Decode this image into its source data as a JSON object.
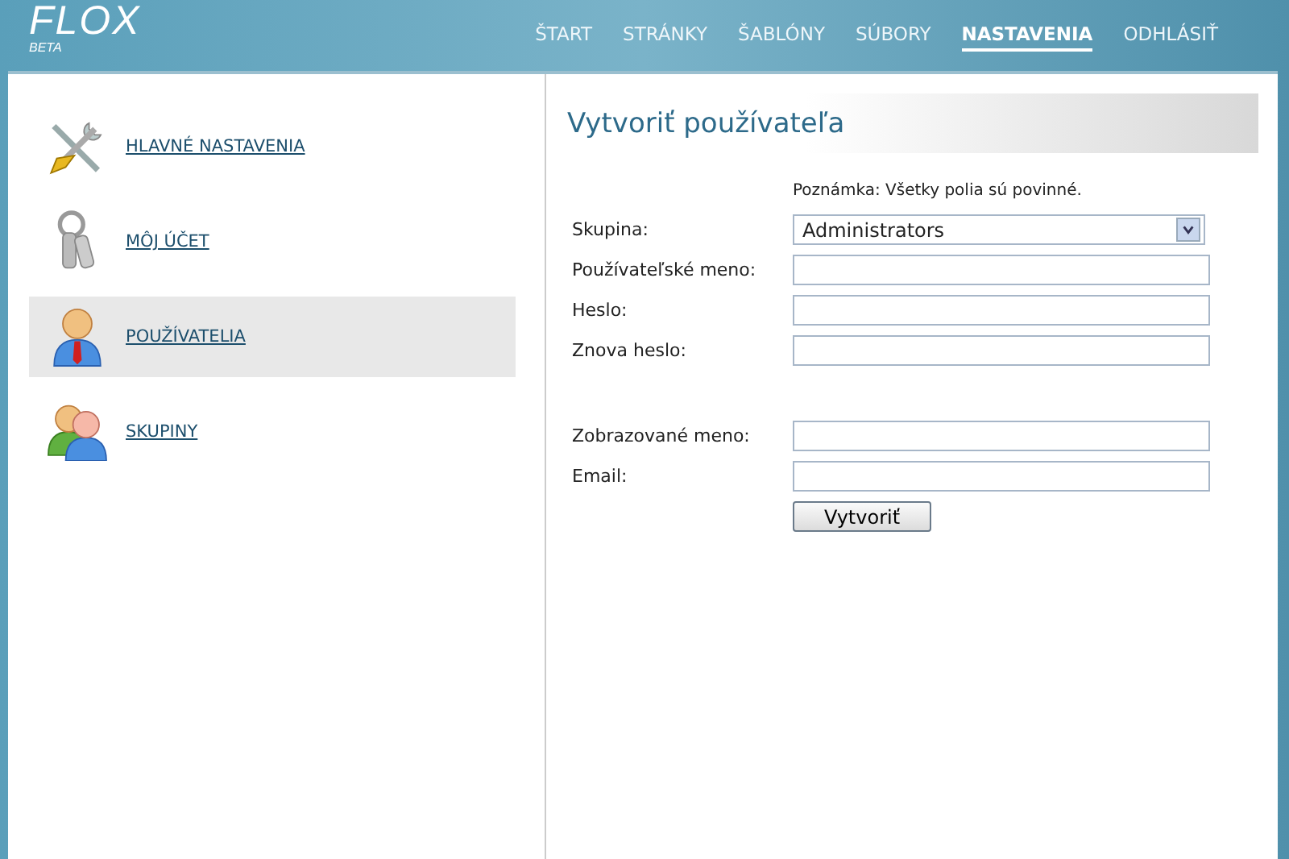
{
  "header": {
    "logo": "FLOX",
    "logo_sub": "BETA",
    "nav": [
      {
        "label": "ŠTART",
        "selected": false
      },
      {
        "label": "STRÁNKY",
        "selected": false
      },
      {
        "label": "ŠABLÓNY",
        "selected": false
      },
      {
        "label": "SÚBORY",
        "selected": false
      },
      {
        "label": "NASTAVENIA",
        "selected": true
      },
      {
        "label": "ODHLÁSIŤ",
        "selected": false
      }
    ]
  },
  "sidebar": {
    "items": [
      {
        "label": "HLAVNÉ NASTAVENIA",
        "selected": false
      },
      {
        "label": "MÔJ ÚČET",
        "selected": false
      },
      {
        "label": "POUŽÍVATELIA",
        "selected": true
      },
      {
        "label": "SKUPINY",
        "selected": false
      }
    ]
  },
  "form": {
    "title": "Vytvoriť používateľa",
    "note": "Poznámka: Všetky polia sú povinné.",
    "groups": [
      [
        {
          "label": "Skupina:",
          "kind": "select",
          "value": "Administrators"
        },
        {
          "label": "Používateľské meno:",
          "kind": "text"
        },
        {
          "label": "Heslo:",
          "kind": "password"
        },
        {
          "label": "Znova heslo:",
          "kind": "password"
        }
      ],
      [
        {
          "label": "Zobrazované meno:",
          "kind": "text"
        },
        {
          "label": "Email:",
          "kind": "text"
        }
      ]
    ],
    "submit": "Vytvoriť"
  }
}
